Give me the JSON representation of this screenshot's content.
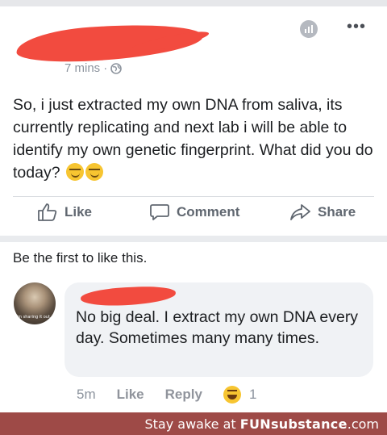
{
  "post": {
    "time": "7 mins",
    "dot": "·",
    "text": "So, i just extracted my own DNA from saliva, its currently replicating and next lab i will be able to identify my own genetic fingerprint. What did you do today?",
    "emoji_icon": "smirk-emoji-icon"
  },
  "actions": {
    "like": "Like",
    "comment": "Comment",
    "share": "Share"
  },
  "likes_prompt": "Be the first to like this.",
  "comment": {
    "avatar_caption": "I'm sharing it out...",
    "text": "No big deal. I extract my own DNA every day. Sometimes many many times.",
    "time": "5m",
    "like": "Like",
    "reply": "Reply",
    "reaction_count": "1",
    "reaction_icon": "laugh-emoji-icon"
  },
  "watermark": {
    "prefix": "Stay awake at ",
    "brand": "FUNsubstance",
    "suffix": ".com"
  },
  "colors": {
    "redaction": "#f24b3f",
    "footer": "#9e4a47",
    "muted_text": "#8d949e"
  }
}
